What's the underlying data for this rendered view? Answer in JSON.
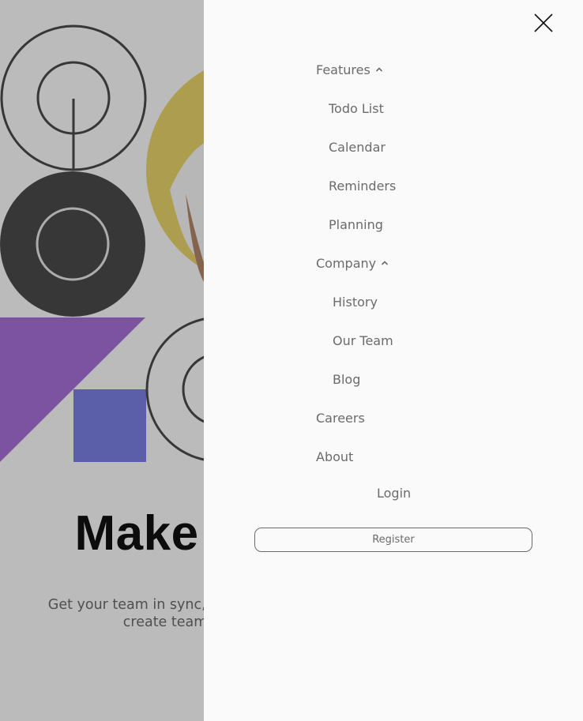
{
  "hero": {
    "title": "Make remote work",
    "subtitle_line1": "Get your team in sync, no matter your location. Streamline processes,",
    "subtitle_line2": "create team rituals, and watch productivity soar."
  },
  "drawer": {
    "close_icon": "close-icon",
    "features": {
      "label": "Features",
      "icon": "chevron-up-icon",
      "items": [
        "Todo List",
        "Calendar",
        "Reminders",
        "Planning"
      ]
    },
    "company": {
      "label": "Company",
      "icon": "chevron-up-icon",
      "items": [
        "History",
        "Our Team",
        "Blog"
      ]
    },
    "careers": "Careers",
    "about": "About",
    "login": "Login",
    "register": "Register"
  },
  "colors": {
    "drawer_bg": "#fafafa",
    "text": "#6b6b6b",
    "overlay": "rgba(0,0,0,0.25)",
    "accent_yellow": "#e7d26a",
    "accent_purple": "#a56fd7",
    "accent_blue": "#7a7ee0",
    "dark_circle": "#4a4a4a"
  }
}
